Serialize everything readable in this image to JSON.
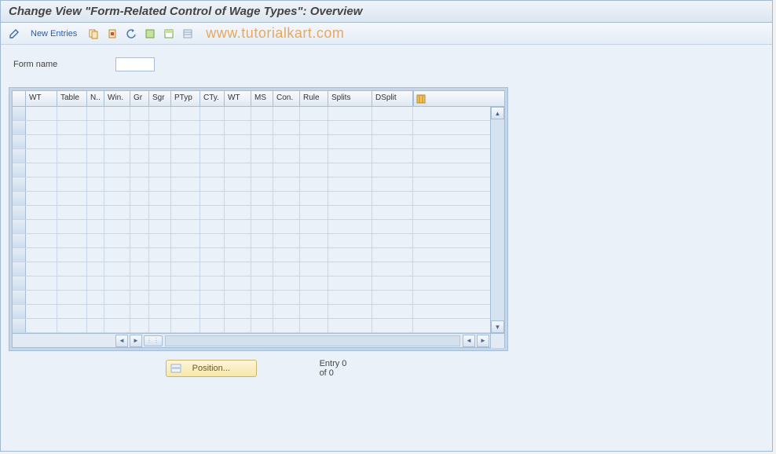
{
  "title": "Change View \"Form-Related Control of Wage Types\": Overview",
  "toolbar": {
    "new_entries": "New Entries"
  },
  "watermark": "www.tutorialkart.com",
  "form": {
    "name_label": "Form name",
    "name_value": ""
  },
  "columns": {
    "wt": "WT",
    "table": "Table",
    "n": "N..",
    "win": "Win.",
    "gr": "Gr",
    "sgr": "Sgr",
    "ptyp": "PTyp",
    "cty": "CTy.",
    "wt2": "WT",
    "ms": "MS",
    "con": "Con.",
    "rule": "Rule",
    "splits": "Splits",
    "dsplit": "DSplit"
  },
  "footer": {
    "position_label": "Position...",
    "entry_text": "Entry 0 of 0"
  }
}
